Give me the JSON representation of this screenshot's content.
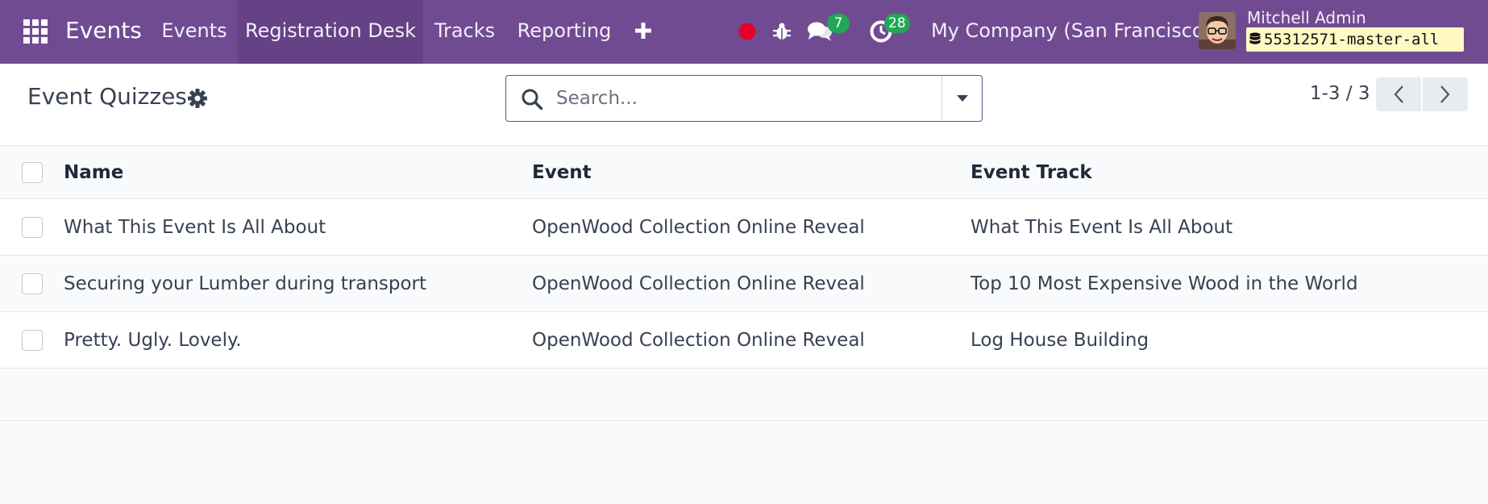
{
  "navbar": {
    "app_title": "Events",
    "menu": [
      "Events",
      "Registration Desk",
      "Tracks",
      "Reporting"
    ],
    "active_menu": "Registration Desk",
    "accent_color": "#714b92",
    "messages_count": "7",
    "activities_count": "28",
    "company": "My Company (San Francisco)",
    "user_name": "Mitchell Admin",
    "database": "55312571-master-all"
  },
  "control_panel": {
    "title": "Event Quizzes",
    "search_placeholder": "Search...",
    "pager": "1-3 / 3"
  },
  "list": {
    "columns": [
      "Name",
      "Event",
      "Event Track"
    ],
    "rows": [
      {
        "name": "What This Event Is All About",
        "event": "OpenWood Collection Online Reveal",
        "track": "What This Event Is All About"
      },
      {
        "name": "Securing your Lumber during transport",
        "event": "OpenWood Collection Online Reveal",
        "track": "Top 10 Most Expensive Wood in the World"
      },
      {
        "name": "Pretty. Ugly. Lovely.",
        "event": "OpenWood Collection Online Reveal",
        "track": "Log House Building"
      }
    ]
  }
}
